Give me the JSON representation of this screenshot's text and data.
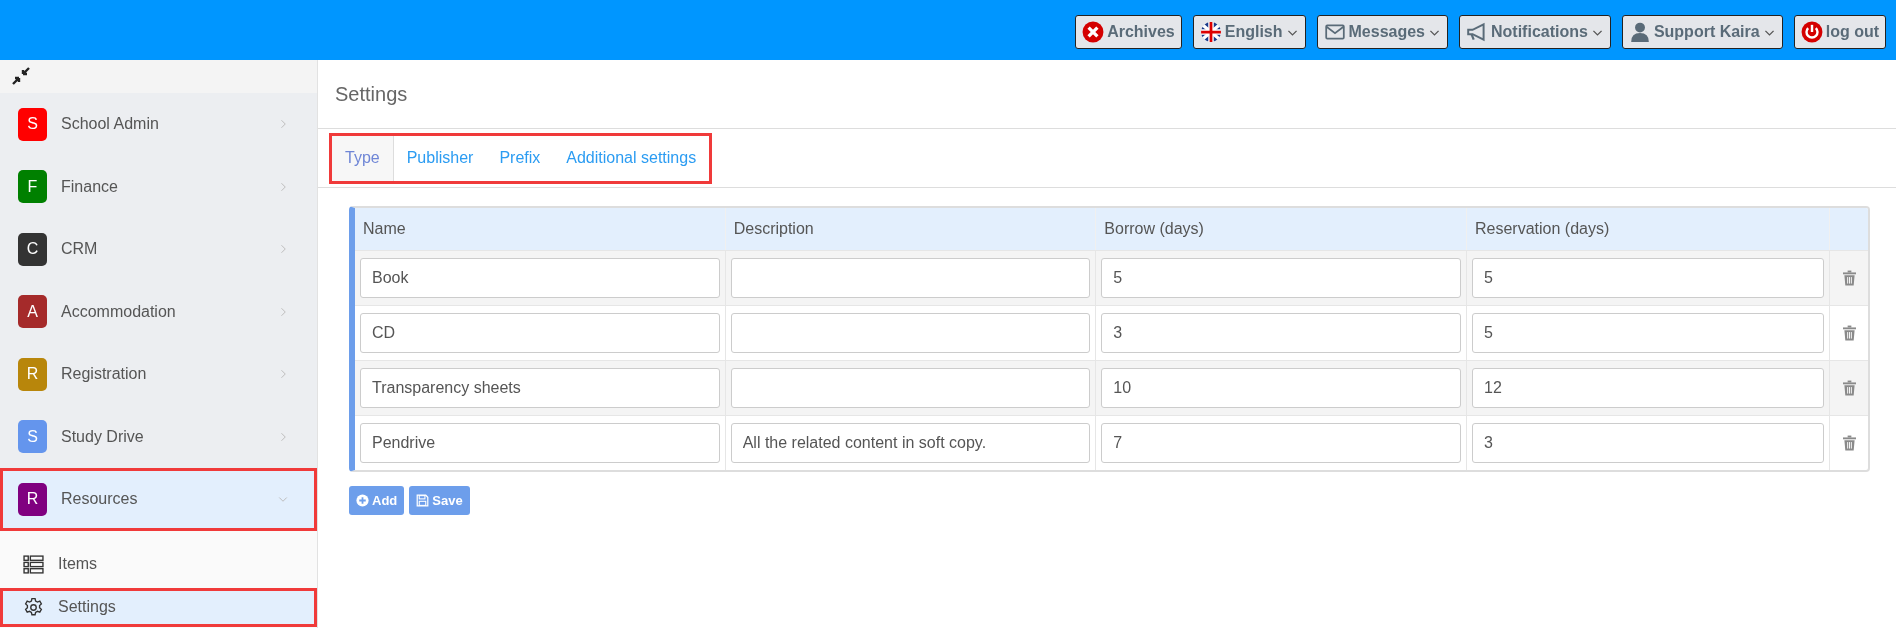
{
  "top_bar": {
    "buttons": [
      {
        "kind": "archives",
        "label": "Archives",
        "dropdown": false
      },
      {
        "kind": "language",
        "label": "English",
        "dropdown": true
      },
      {
        "kind": "messages",
        "label": "Messages",
        "dropdown": true
      },
      {
        "kind": "notifications",
        "label": "Notifications",
        "dropdown": true
      },
      {
        "kind": "user",
        "label": "Support Kaira",
        "dropdown": true
      },
      {
        "kind": "logout",
        "label": "log out",
        "dropdown": false
      }
    ]
  },
  "sidebar": {
    "items": [
      {
        "letter": "S",
        "label": "School Admin",
        "color": "#ff0000",
        "expanded": false,
        "highlighted": false
      },
      {
        "letter": "F",
        "label": "Finance",
        "color": "#008000",
        "expanded": false,
        "highlighted": false
      },
      {
        "letter": "C",
        "label": "CRM",
        "color": "#333333",
        "expanded": false,
        "highlighted": false
      },
      {
        "letter": "A",
        "label": "Accommodation",
        "color": "#a52a2a",
        "expanded": false,
        "highlighted": false
      },
      {
        "letter": "R",
        "label": "Registration",
        "color": "#b8860b",
        "expanded": false,
        "highlighted": false
      },
      {
        "letter": "S",
        "label": "Study Drive",
        "color": "#6495ed",
        "expanded": false,
        "highlighted": false
      },
      {
        "letter": "R",
        "label": "Resources",
        "color": "#800080",
        "expanded": true,
        "highlighted": true,
        "children": [
          {
            "kind": "list",
            "label": "Items",
            "selected": false,
            "highlighted": false
          },
          {
            "kind": "settings",
            "label": "Settings",
            "selected": true,
            "highlighted": true
          }
        ]
      }
    ]
  },
  "page": {
    "title": "Settings"
  },
  "tabs": {
    "highlighted": true,
    "items": [
      {
        "label": "Type",
        "selected": true
      },
      {
        "label": "Publisher",
        "selected": false
      },
      {
        "label": "Prefix",
        "selected": false
      },
      {
        "label": "Additional settings",
        "selected": false
      }
    ]
  },
  "table": {
    "columns": [
      "Name",
      "Description",
      "Borrow (days)",
      "Reservation (days)"
    ],
    "rows": [
      {
        "name": "Book",
        "description": "",
        "borrow": "5",
        "reservation": "5"
      },
      {
        "name": "CD",
        "description": "",
        "borrow": "3",
        "reservation": "5"
      },
      {
        "name": "Transparency sheets",
        "description": "",
        "borrow": "10",
        "reservation": "12"
      },
      {
        "name": "Pendrive",
        "description": "All the related content in soft copy.",
        "borrow": "7",
        "reservation": "3"
      }
    ]
  },
  "actions": [
    {
      "kind": "add",
      "label": "Add"
    },
    {
      "kind": "save",
      "label": "Save"
    }
  ]
}
